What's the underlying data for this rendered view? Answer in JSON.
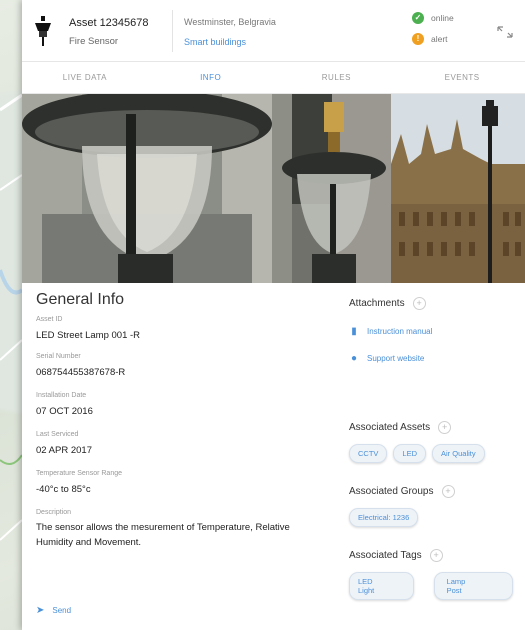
{
  "header": {
    "title": "Asset 12345678",
    "subtitle": "Fire Sensor",
    "location": "Westminster, Belgravia",
    "group_link": "Smart buildings",
    "status_online": "online",
    "status_alert": "alert"
  },
  "tabs": [
    {
      "label": "LIVE DATA",
      "active": false
    },
    {
      "label": "INFO",
      "active": true
    },
    {
      "label": "RULES",
      "active": false
    },
    {
      "label": "EVENTS",
      "active": false
    }
  ],
  "general": {
    "title": "General Info",
    "fields": [
      {
        "label": "Asset ID",
        "value": "LED Street Lamp 001 -R"
      },
      {
        "label": "Serial Number",
        "value": "068754455387678-R"
      },
      {
        "label": "Installation Date",
        "value": "07 OCT 2016"
      },
      {
        "label": "Last Serviced",
        "value": "02 APR 2017"
      },
      {
        "label": "Temperature Sensor Range",
        "value": "-40°c to 85°c"
      },
      {
        "label": "Description",
        "value": "The sensor allows the mesurement of Temperature, Relative Humidity and Movement."
      }
    ],
    "send": "Send"
  },
  "attachments": {
    "title": "Attachments",
    "links": [
      "Instruction manual",
      "Support website"
    ]
  },
  "associated_assets": {
    "title": "Associated Assets",
    "chips": [
      "CCTV",
      "LED",
      "Air Quality"
    ]
  },
  "associated_groups": {
    "title": "Associated Groups",
    "chips": [
      "Electrical: 1236"
    ]
  },
  "associated_tags": {
    "title": "Associated Tags",
    "chips": [
      "LED Light",
      "Lamp Post"
    ]
  },
  "colors": {
    "accent": "#4a90d9",
    "online": "#4caf50",
    "alert": "#f0a020"
  },
  "icons": {
    "asset": "street-lamp-icon",
    "online": "check-circle-icon",
    "alert": "exclamation-circle-icon",
    "toggle": "expand-arrows-icon",
    "attach": "file-icon",
    "web": "globe-icon",
    "send": "send-icon",
    "add": "plus-circle-icon"
  }
}
